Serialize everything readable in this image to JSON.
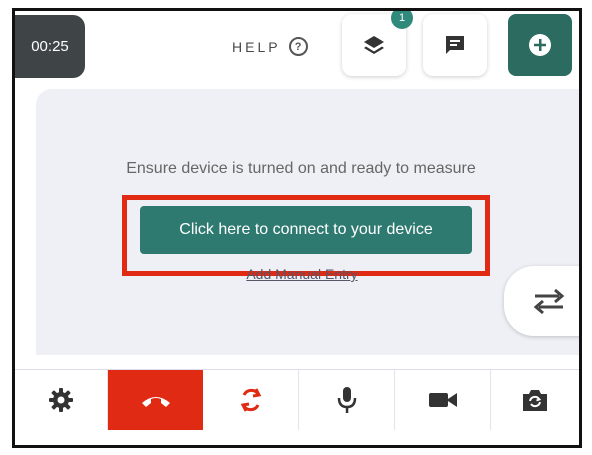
{
  "header": {
    "timer": "00:25",
    "help_label": "HELP",
    "help_icon_glyph": "?",
    "layers_badge": "1",
    "icons": [
      "layers-icon",
      "chat-icon",
      "add-icon"
    ]
  },
  "main": {
    "instruction": "Ensure device is turned on and ready to measure",
    "connect_button": "Click here to connect to your device",
    "manual_entry_link": "Add Manual Entry",
    "swap_icon": "swap-arrows-icon"
  },
  "bottom_bar": {
    "icons": [
      "gear-icon",
      "end-call-icon",
      "refresh-icon",
      "microphone-icon",
      "video-camera-icon",
      "switch-camera-icon"
    ]
  },
  "colors": {
    "accent": "#2f7a70",
    "add_button": "#2b6b60",
    "badge": "#2f8a7c",
    "end_call": "#e02a13",
    "highlight": "#e02a13",
    "panel_bg": "#eef0f5",
    "timer_bg": "#3f4447"
  }
}
